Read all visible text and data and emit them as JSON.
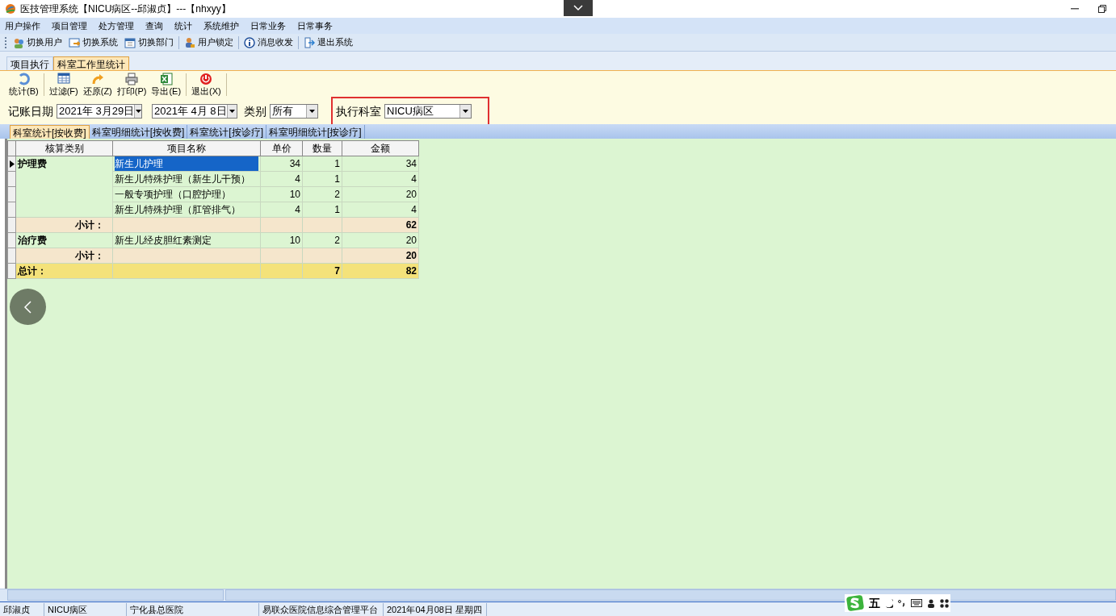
{
  "window": {
    "title": "医技管理系统【NICU病区--邱淑贞】---【nhxyy】"
  },
  "menu": [
    "用户操作",
    "项目管理",
    "处方管理",
    "查询",
    "统计",
    "系统维护",
    "日常业务",
    "日常事务"
  ],
  "toolbar": [
    "切换用户",
    "切换系统",
    "切换部门",
    "用户锁定",
    "消息收发",
    "退出系统"
  ],
  "tabs": [
    {
      "label": "项目执行",
      "selected": false
    },
    {
      "label": "科室工作里统计",
      "selected": true
    }
  ],
  "actions": [
    "统计(B)",
    "过滤(F)",
    "还原(Z)",
    "打印(P)",
    "导出(E)",
    "退出(X)"
  ],
  "filters": {
    "date_label": "记账日期",
    "date_from": "2021年  3月29日",
    "date_to": "2021年  4月  8日",
    "category_label": "类别",
    "category": "所有",
    "dept_label": "执行科室",
    "dept": "NICU病区"
  },
  "subtabs": [
    {
      "label": "科室统计[按收费]",
      "selected": true
    },
    {
      "label": "科室明细统计[按收费]",
      "selected": false
    },
    {
      "label": "科室统计[按诊疗]",
      "selected": false
    },
    {
      "label": "科室明细统计[按诊疗]",
      "selected": false
    }
  ],
  "table": {
    "columns": [
      "核算类别",
      "项目名称",
      "单价",
      "数量",
      "金额"
    ],
    "rows": [
      {
        "kind": "item",
        "selected": true,
        "category": "护理费",
        "name": "新生儿护理",
        "price": "34",
        "qty": "1",
        "amount": "34"
      },
      {
        "kind": "item",
        "selected": false,
        "name": "新生儿特殊护理（新生儿干预）",
        "price": "4",
        "qty": "1",
        "amount": "4"
      },
      {
        "kind": "item",
        "selected": false,
        "name": "一般专项护理（口腔护理）",
        "price": "10",
        "qty": "2",
        "amount": "20"
      },
      {
        "kind": "item",
        "selected": false,
        "name": "新生儿特殊护理（肛管排气）",
        "price": "4",
        "qty": "1",
        "amount": "4"
      },
      {
        "kind": "subtotal",
        "selected": false,
        "category": "小计：",
        "amount": "62"
      },
      {
        "kind": "item",
        "selected": false,
        "category": "治疗费",
        "name": "新生儿经皮胆红素测定",
        "price": "10",
        "qty": "2",
        "amount": "20"
      },
      {
        "kind": "subtotal",
        "selected": false,
        "category": "小计：",
        "amount": "20"
      },
      {
        "kind": "total",
        "selected": false,
        "category": "总计：",
        "qty": "7",
        "amount": "82"
      }
    ]
  },
  "status_bar": [
    "邱淑贞",
    "NICU病区",
    "宁化县总医院",
    "易联众医院信息综合管理平台",
    "2021年04月08日  星期四"
  ],
  "ime": [
    "五"
  ]
}
